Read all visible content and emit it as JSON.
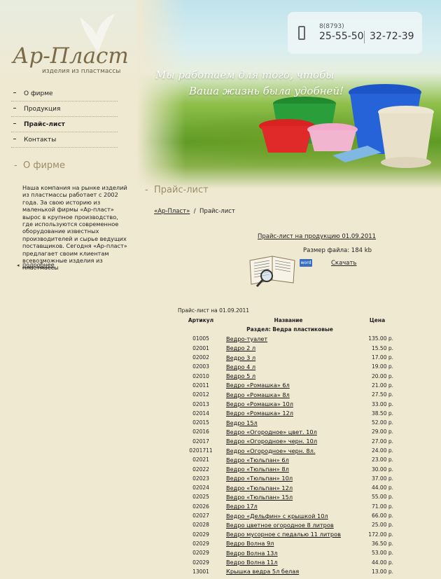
{
  "header": {
    "logo": "Ар-Пласт",
    "logo_subtitle": "изделия из пластмассы",
    "phone_code": "8(8793)",
    "phone1": "25-55-50",
    "phone2": "32-72-39",
    "slogan_line1": "Мы работаем для того, чтобы",
    "slogan_line2": "Ваша жизнь была удобней!"
  },
  "nav": {
    "items": [
      {
        "label": "О фирме"
      },
      {
        "label": "Продукция"
      },
      {
        "label": "Прайс-лист"
      },
      {
        "label": "Контакты"
      }
    ]
  },
  "sidebar": {
    "title": "О фирме",
    "text": "Наша компания на рынке изделий из пластмассы работает с 2002 года. За свою историю из маленькой фирмы «Ар-пласт» вырос в крупное производство, где используются современное оборудование известных производителей и сырье ведущих поставщиков. Сегодня «Ар-пласт» предлагает своим клиентам всевозможные изделия из пластмассы",
    "more": "подробнее"
  },
  "main": {
    "title": "Прайс-лист",
    "breadcrumb_home": "«Ар-Пласт»",
    "breadcrumb_sep": "/",
    "breadcrumb_current": "Прайс-лист",
    "doc_link": "Прайс-лист на продукцию 01.09.2011",
    "file_size": "Размер файла: 184 kb",
    "word_label": "word",
    "download": "Скачать"
  },
  "table": {
    "caption": "Прайс-лист на 01.09.2011",
    "headers": {
      "article": "Артикул",
      "name": "Название",
      "price": "Цена"
    },
    "section": "Раздел: Ведра пластиковые",
    "rows": [
      {
        "article": "01005",
        "name": "Ведро-туалет",
        "price": "135.00 р."
      },
      {
        "article": "02001",
        "name": "Ведро 2 л",
        "price": "15.50 р."
      },
      {
        "article": "02002",
        "name": "Ведро 3 л",
        "price": "17.00 р."
      },
      {
        "article": "02003",
        "name": "Ведро 4 л",
        "price": "19.00 р."
      },
      {
        "article": "02010",
        "name": "Ведро 5 л",
        "price": "20.00 р."
      },
      {
        "article": "02011",
        "name": "Ведро «Ромашка» 6л",
        "price": "21.00 р."
      },
      {
        "article": "02012",
        "name": "Ведро «Ромашка» 8л",
        "price": "27.50 р."
      },
      {
        "article": "02013",
        "name": "Ведро «Ромашка» 10л",
        "price": "33.00 р."
      },
      {
        "article": "02014",
        "name": "Ведро «Ромашка» 12л",
        "price": "38.50 р."
      },
      {
        "article": "02015",
        "name": "Ведро 15л",
        "price": "52.00 р."
      },
      {
        "article": "02016",
        "name": "Ведро «Огородное» цвет. 10л",
        "price": "29.00 р."
      },
      {
        "article": "02017",
        "name": "Ведро «Огородное» черн. 10л",
        "price": "27.00 р."
      },
      {
        "article": "0201711",
        "name": "Ведро «Огородное» черн. 8л.",
        "price": "24.00 р."
      },
      {
        "article": "02021",
        "name": "Ведро «Тюльпан» 6л",
        "price": "23.00 р."
      },
      {
        "article": "02022",
        "name": "Ведро «Тюльпан» 8л",
        "price": "30.00 р."
      },
      {
        "article": "02023",
        "name": "Ведро «Тюльпан» 10л",
        "price": "37.00 р."
      },
      {
        "article": "02024",
        "name": "Ведро «Тюльпан» 12л",
        "price": "44.00 р."
      },
      {
        "article": "02025",
        "name": "Ведро «Тюльпан» 15л",
        "price": "55.00 р."
      },
      {
        "article": "02026",
        "name": "Ведро 17л",
        "price": "71.00 р."
      },
      {
        "article": "02027",
        "name": "Ведро «Дельфин» с крышкой 10л",
        "price": "66.00 р."
      },
      {
        "article": "02028",
        "name": "Ведро цветное огородное 8 литров",
        "price": "25.00 р."
      },
      {
        "article": "02029",
        "name": "Ведро мусорное с педалью 11 литров",
        "price": "172.00 р."
      },
      {
        "article": "02029",
        "name": "Ведро Волна 9л",
        "price": "36.50 р."
      },
      {
        "article": "02029",
        "name": "Ведро Волна 13л",
        "price": "53.00 р."
      },
      {
        "article": "02029",
        "name": "Ведро Волна 11л",
        "price": "44.00 р."
      },
      {
        "article": "13001",
        "name": "Крышка ведра 5л белая",
        "price": "13.00 р."
      }
    ]
  }
}
